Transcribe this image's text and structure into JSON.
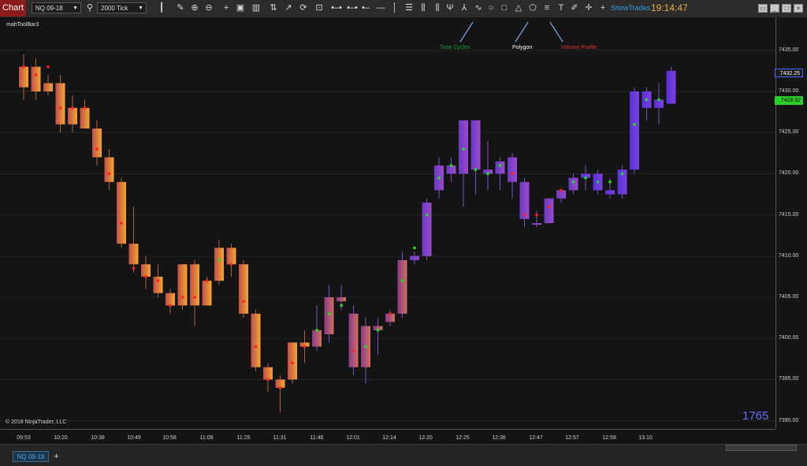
{
  "toolbar": {
    "chart_tab": "Chart",
    "instrument": "NQ 09-18",
    "interval": "2000 Tick",
    "show_trades": "ShowTrades",
    "clock": "19:14:47",
    "text_tool": "T",
    "window_buttons": [
      "restore",
      "minimize",
      "maximize",
      "close"
    ]
  },
  "chart": {
    "indicator_label": "mahToolBar3",
    "copyright": "© 2018 NinjaTrader, LLC",
    "bar_count": "1765",
    "annotations": [
      {
        "text": "Time Cycles",
        "color": "#1a9a3a"
      },
      {
        "text": "Polygon",
        "color": "#ffffff"
      },
      {
        "text": "Volume Profile",
        "color": "#e03030"
      }
    ],
    "y_ticks": [
      "7435.00",
      "7430.00",
      "7425.00",
      "7420.00",
      "7415.00",
      "7410.00",
      "7405.00",
      "7400.00",
      "7395.00",
      "7390.00"
    ],
    "last_price": "7432.25",
    "bid_price": "7428.92",
    "x_ticks": [
      "09:53",
      "10:20",
      "10:38",
      "10:49",
      "10:58",
      "11:09",
      "11:25",
      "11:31",
      "11:46",
      "12:01",
      "12:14",
      "12:20",
      "12:25",
      "12:36",
      "12:47",
      "12:57",
      "12:59",
      "13:10"
    ]
  },
  "bottom": {
    "tab": "NQ 09-18",
    "add": "+"
  },
  "chart_data": {
    "type": "candlestick",
    "title": "",
    "ylim": [
      7389,
      7439
    ],
    "bars": [
      {
        "o": 7430.5,
        "h": 7434.5,
        "l": 7429.0,
        "c": 7433.0,
        "dot": 7433.0,
        "dc": "red"
      },
      {
        "o": 7433.0,
        "h": 7434.0,
        "l": 7429.0,
        "c": 7430.0,
        "dot": 7432.0,
        "dc": "red"
      },
      {
        "o": 7430.0,
        "h": 7432.0,
        "l": 7429.5,
        "c": 7431.0,
        "dot": 7433.0,
        "dc": "red"
      },
      {
        "o": 7431.0,
        "h": 7432.0,
        "l": 7425.0,
        "c": 7426.0,
        "dot": 7428.0,
        "dc": "red"
      },
      {
        "o": 7426.0,
        "h": 7429.5,
        "l": 7425.0,
        "c": 7428.0,
        "dot": 7428.0,
        "dc": "red"
      },
      {
        "o": 7428.0,
        "h": 7429.0,
        "l": 7425.5,
        "c": 7425.5,
        "dot": 7428.0,
        "dc": "red"
      },
      {
        "o": 7425.5,
        "h": 7426.5,
        "l": 7421.0,
        "c": 7422.0,
        "dot": 7423.0,
        "dc": "red"
      },
      {
        "o": 7422.0,
        "h": 7423.0,
        "l": 7418.0,
        "c": 7419.0,
        "dot": 7420.0,
        "dc": "red"
      },
      {
        "o": 7419.0,
        "h": 7419.5,
        "l": 7411.0,
        "c": 7411.5,
        "dot": 7414.0,
        "dc": "red"
      },
      {
        "o": 7411.5,
        "h": 7416.0,
        "l": 7408.0,
        "c": 7409.0,
        "dot": 7408.5,
        "dc": "red"
      },
      {
        "o": 7409.0,
        "h": 7410.0,
        "l": 7406.0,
        "c": 7407.5,
        "dot": 7407.5,
        "dc": "red"
      },
      {
        "o": 7407.5,
        "h": 7409.0,
        "l": 7405.0,
        "c": 7405.5,
        "dot": 7407.0,
        "dc": "red"
      },
      {
        "o": 7405.5,
        "h": 7406.0,
        "l": 7403.0,
        "c": 7404.0,
        "dot": 7404.0,
        "dc": "red"
      },
      {
        "o": 7404.0,
        "h": 7409.0,
        "l": 7403.5,
        "c": 7409.0,
        "dot": 7405.0,
        "dc": "red"
      },
      {
        "o": 7409.0,
        "h": 7409.5,
        "l": 7401.5,
        "c": 7404.0,
        "dot": 7405.0,
        "dc": "red"
      },
      {
        "o": 7404.0,
        "h": 7407.5,
        "l": 7404.0,
        "c": 7407.0,
        "dot": 7407.0,
        "dc": "red"
      },
      {
        "o": 7407.0,
        "h": 7412.0,
        "l": 7406.5,
        "c": 7411.0,
        "dot": 7409.5,
        "dc": "green"
      },
      {
        "o": 7411.0,
        "h": 7411.5,
        "l": 7407.5,
        "c": 7409.0,
        "dot": 7409.0,
        "dc": "red"
      },
      {
        "o": 7409.0,
        "h": 7409.5,
        "l": 7402.5,
        "c": 7403.0,
        "dot": 7404.5,
        "dc": "red"
      },
      {
        "o": 7403.0,
        "h": 7403.5,
        "l": 7396.0,
        "c": 7396.5,
        "dot": 7399.0,
        "dc": "red"
      },
      {
        "o": 7396.5,
        "h": 7397.0,
        "l": 7393.5,
        "c": 7395.0,
        "dot": 7395.0,
        "dc": "red"
      },
      {
        "o": 7395.0,
        "h": 7395.5,
        "l": 7391.0,
        "c": 7394.0,
        "dot": 7394.0,
        "dc": "red"
      },
      {
        "o": 7395.0,
        "h": 7399.5,
        "l": 7394.5,
        "c": 7399.5,
        "dot": 7397.0,
        "dc": "red"
      },
      {
        "o": 7399.5,
        "h": 7401.0,
        "l": 7397.0,
        "c": 7399.0,
        "dot": 7399.0,
        "dc": "red"
      },
      {
        "o": 7399.0,
        "h": 7404.0,
        "l": 7398.5,
        "c": 7401.0,
        "dot": 7401.0,
        "dc": "green"
      },
      {
        "o": 7400.5,
        "h": 7406.5,
        "l": 7399.5,
        "c": 7405.0,
        "dot": 7403.0,
        "dc": "green"
      },
      {
        "o": 7405.0,
        "h": 7406.5,
        "l": 7403.5,
        "c": 7404.5,
        "dot": 7404.0,
        "dc": "green"
      },
      {
        "o": 7403.0,
        "h": 7404.0,
        "l": 7395.5,
        "c": 7396.5,
        "dot": 7398.5,
        "dc": "red"
      },
      {
        "o": 7396.5,
        "h": 7402.5,
        "l": 7394.5,
        "c": 7401.5,
        "dot": 7399.0,
        "dc": "green"
      },
      {
        "o": 7401.5,
        "h": 7402.5,
        "l": 7398.0,
        "c": 7401.0,
        "dot": 7401.0,
        "dc": "green"
      },
      {
        "o": 7402.0,
        "h": 7403.5,
        "l": 7401.5,
        "c": 7403.0,
        "dot": 7403.0,
        "dc": "red"
      },
      {
        "o": 7403.0,
        "h": 7410.5,
        "l": 7402.5,
        "c": 7409.5,
        "dot": 7407.0,
        "dc": "green"
      },
      {
        "o": 7409.5,
        "h": 7410.5,
        "l": 7409.0,
        "c": 7410.0,
        "dot": 7411.0,
        "dc": "green"
      },
      {
        "o": 7410.0,
        "h": 7417.0,
        "l": 7409.5,
        "c": 7416.5,
        "dot": 7415.0,
        "dc": "green"
      },
      {
        "o": 7418.0,
        "h": 7422.0,
        "l": 7417.0,
        "c": 7421.0,
        "dot": 7419.5,
        "dc": "green"
      },
      {
        "o": 7420.0,
        "h": 7422.0,
        "l": 7419.0,
        "c": 7421.0,
        "dot": 7421.0,
        "dc": "green"
      },
      {
        "o": 7420.0,
        "h": 7426.5,
        "l": 7416.0,
        "c": 7426.5,
        "dot": 7423.0,
        "dc": "green"
      },
      {
        "o": 7426.5,
        "h": 7426.5,
        "l": 7417.5,
        "c": 7420.5,
        "dot": 7420.5,
        "dc": "green"
      },
      {
        "o": 7420.5,
        "h": 7424.0,
        "l": 7418.0,
        "c": 7420.0,
        "dot": 7420.0,
        "dc": "green"
      },
      {
        "o": 7420.0,
        "h": 7422.0,
        "l": 7418.0,
        "c": 7421.5,
        "dot": 7421.0,
        "dc": "green"
      },
      {
        "o": 7422.0,
        "h": 7422.5,
        "l": 7417.0,
        "c": 7419.0,
        "dot": 7420.0,
        "dc": "red"
      },
      {
        "o": 7419.0,
        "h": 7419.5,
        "l": 7413.5,
        "c": 7414.5,
        "dot": 7415.0,
        "dc": "red"
      },
      {
        "o": 7414.0,
        "h": 7415.5,
        "l": 7413.5,
        "c": 7414.0,
        "dot": 7415.0,
        "dc": "red"
      },
      {
        "o": 7414.0,
        "h": 7417.0,
        "l": 7414.0,
        "c": 7417.0,
        "dot": 7416.0,
        "dc": "red"
      },
      {
        "o": 7417.0,
        "h": 7418.0,
        "l": 7416.5,
        "c": 7418.0,
        "dot": 7418.0,
        "dc": "red"
      },
      {
        "o": 7418.0,
        "h": 7420.0,
        "l": 7417.5,
        "c": 7419.5,
        "dot": 7419.0,
        "dc": "green"
      },
      {
        "o": 7419.5,
        "h": 7421.0,
        "l": 7418.0,
        "c": 7420.0,
        "dot": 7419.5,
        "dc": "green"
      },
      {
        "o": 7420.0,
        "h": 7420.5,
        "l": 7417.5,
        "c": 7418.0,
        "dot": 7419.0,
        "dc": "green"
      },
      {
        "o": 7418.0,
        "h": 7419.5,
        "l": 7417.0,
        "c": 7417.5,
        "dot": 7419.0,
        "dc": "green"
      },
      {
        "o": 7417.5,
        "h": 7421.0,
        "l": 7417.0,
        "c": 7420.5,
        "dot": 7420.0,
        "dc": "green"
      },
      {
        "o": 7420.5,
        "h": 7430.5,
        "l": 7420.0,
        "c": 7430.0,
        "dot": 7426.0,
        "dc": "green"
      },
      {
        "o": 7428.0,
        "h": 7430.5,
        "l": 7426.5,
        "c": 7430.0,
        "dot": 7429.0,
        "dc": "green"
      },
      {
        "o": 7428.0,
        "h": 7431.0,
        "l": 7426.0,
        "c": 7429.0,
        "dot": 7429.0,
        "dc": "green"
      },
      {
        "o": 7428.5,
        "h": 7433.0,
        "l": 7428.5,
        "c": 7432.5,
        "dot": null,
        "dc": "green"
      }
    ]
  }
}
